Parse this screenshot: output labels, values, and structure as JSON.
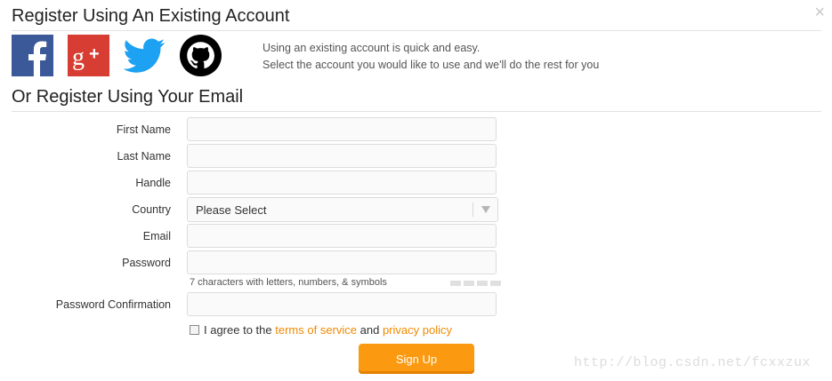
{
  "header": {
    "existing_title": "Register Using An Existing Account",
    "close_icon": "close-icon",
    "close_glyph": "×"
  },
  "social": {
    "providers": [
      {
        "name": "facebook",
        "icon": "facebook-icon",
        "color": "#3b5998"
      },
      {
        "name": "google-plus",
        "icon": "google-plus-icon",
        "color": "#dd4b39"
      },
      {
        "name": "twitter",
        "icon": "twitter-icon",
        "color": "#1da1f2"
      },
      {
        "name": "github",
        "icon": "github-icon",
        "color": "#000000"
      }
    ],
    "line1": "Using an existing account is quick and easy.",
    "line2": "Select the account you would like to use and we'll do the rest for you"
  },
  "email_section": {
    "title": "Or Register Using Your Email"
  },
  "form": {
    "first_name_label": "First Name",
    "first_name_value": "",
    "last_name_label": "Last Name",
    "last_name_value": "",
    "handle_label": "Handle",
    "handle_value": "",
    "country_label": "Country",
    "country_value": "Please Select",
    "email_label": "Email",
    "email_value": "",
    "password_label": "Password",
    "password_value": "",
    "password_hint": "7 characters with letters, numbers, & symbols",
    "password_confirm_label": "Password Confirmation",
    "password_confirm_value": ""
  },
  "agreement": {
    "prefix": "I agree to the",
    "terms_link": "terms of service",
    "middle": "and",
    "privacy_link": "privacy policy",
    "checked": false
  },
  "actions": {
    "signup_label": "Sign Up"
  },
  "watermark": {
    "text": "http://blog.csdn.net/fcxxzux"
  },
  "colors": {
    "accent": "#fb9a10",
    "link": "#f08a00"
  }
}
